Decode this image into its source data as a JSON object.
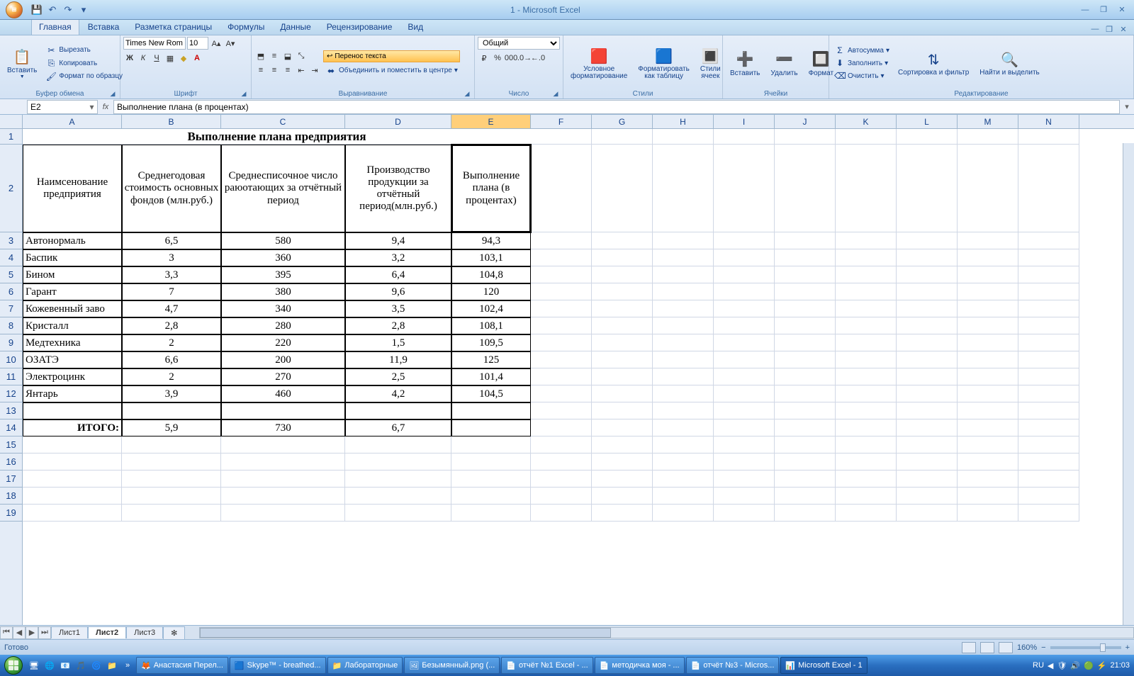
{
  "app_title": "1 - Microsoft Excel",
  "tabs": [
    "Главная",
    "Вставка",
    "Разметка страницы",
    "Формулы",
    "Данные",
    "Рецензирование",
    "Вид"
  ],
  "active_tab": 0,
  "ribbon": {
    "clipboard": {
      "paste": "Вставить",
      "cut": "Вырезать",
      "copy": "Копировать",
      "format_painter": "Формат по образцу",
      "label": "Буфер обмена"
    },
    "font": {
      "name": "Times New Rom",
      "size": "10",
      "label": "Шрифт"
    },
    "alignment": {
      "wrap": "Перенос текста",
      "merge": "Объединить и поместить в центре",
      "label": "Выравнивание"
    },
    "number": {
      "format": "Общий",
      "label": "Число"
    },
    "styles": {
      "cond": "Условное форматирование",
      "astable": "Форматировать как таблицу",
      "cellstyles": "Стили ячеек",
      "label": "Стили"
    },
    "cells": {
      "insert": "Вставить",
      "delete": "Удалить",
      "format": "Формат",
      "label": "Ячейки"
    },
    "editing": {
      "autosum": "Автосумма",
      "fill": "Заполнить",
      "clear": "Очистить",
      "sort": "Сортировка и фильтр",
      "find": "Найти и выделить",
      "label": "Редактирование"
    }
  },
  "namebox": "E2",
  "formula": "Выполнение плана (в процентах)",
  "columns": [
    "A",
    "B",
    "C",
    "D",
    "E",
    "F",
    "G",
    "H",
    "I",
    "J",
    "K",
    "L",
    "M",
    "N"
  ],
  "selected_col": "E",
  "row_count": 19,
  "data_title": "Выполнение плана предприятия",
  "headers": {
    "A": "Наимсенование предприятия",
    "B": "Среднегодовая стоимость основных фондов (млн.руб.)",
    "C": "Среднесписочное число раюотающих за отчётный период",
    "D": "Производство продукции за отчётный период(млн.руб.)",
    "E": "Выполнение плана (в процентах)"
  },
  "rows": [
    {
      "A": "Автонормаль",
      "B": "6,5",
      "C": "580",
      "D": "9,4",
      "E": "94,3"
    },
    {
      "A": "Баспик",
      "B": "3",
      "C": "360",
      "D": "3,2",
      "E": "103,1"
    },
    {
      "A": "Бином",
      "B": "3,3",
      "C": "395",
      "D": "6,4",
      "E": "104,8"
    },
    {
      "A": "Гарант",
      "B": "7",
      "C": "380",
      "D": "9,6",
      "E": "120"
    },
    {
      "A": "Кожевенный заво",
      "B": "4,7",
      "C": "340",
      "D": "3,5",
      "E": "102,4"
    },
    {
      "A": "Кристалл",
      "B": "2,8",
      "C": "280",
      "D": "2,8",
      "E": "108,1"
    },
    {
      "A": "Медтехника",
      "B": "2",
      "C": "220",
      "D": "1,5",
      "E": "109,5"
    },
    {
      "A": "ОЗАТЭ",
      "B": "6,6",
      "C": "200",
      "D": "11,9",
      "E": "125"
    },
    {
      "A": "Электроцинк",
      "B": "2",
      "C": "270",
      "D": "2,5",
      "E": "101,4"
    },
    {
      "A": "Янтарь",
      "B": "3,9",
      "C": "460",
      "D": "4,2",
      "E": "104,5"
    }
  ],
  "total_label": "ИТОГО:",
  "total": {
    "B": "5,9",
    "C": "730",
    "D": "6,7",
    "E": ""
  },
  "sheets": [
    "Лист1",
    "Лист2",
    "Лист3"
  ],
  "active_sheet": 1,
  "status": "Готово",
  "zoom": "160%",
  "taskbar": {
    "items": [
      {
        "icon": "🦊",
        "label": "Анастасия Перел..."
      },
      {
        "icon": "🟦",
        "label": "Skype™ - breathed..."
      },
      {
        "icon": "📁",
        "label": "Лабораторные"
      },
      {
        "icon": "🖼",
        "label": "Безымянный.png (..."
      },
      {
        "icon": "📄",
        "label": "отчёт №1 Excel - ..."
      },
      {
        "icon": "📄",
        "label": "методичка моя - ..."
      },
      {
        "icon": "📄",
        "label": "отчёт №3 - Micros..."
      },
      {
        "icon": "📊",
        "label": "Microsoft Excel - 1"
      }
    ],
    "lang": "RU",
    "time": "21:03"
  }
}
